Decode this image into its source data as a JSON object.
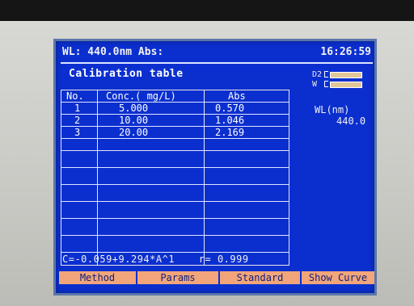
{
  "status_bar": {
    "wavelength_abs": "WL: 440.0nm Abs:",
    "time": "16:26:59"
  },
  "page": {
    "title": "Calibration table"
  },
  "lamps": [
    {
      "label": "D2"
    },
    {
      "label": "W"
    }
  ],
  "table": {
    "headers": [
      "No.",
      "Conc.( mg/L)",
      "Abs"
    ],
    "rows": [
      [
        "1",
        "5.000",
        "0.570"
      ],
      [
        "2",
        "10.00",
        "1.046"
      ],
      [
        "3",
        "20.00",
        "2.169"
      ],
      [
        "",
        "",
        ""
      ],
      [
        "",
        "",
        ""
      ],
      [
        "",
        "",
        ""
      ],
      [
        "",
        "",
        ""
      ],
      [
        "",
        "",
        ""
      ],
      [
        "",
        "",
        ""
      ],
      [
        "",
        "",
        ""
      ],
      [
        "",
        "",
        ""
      ],
      [
        "",
        "",
        ""
      ]
    ]
  },
  "side_panel": {
    "wl_label": "WL(nm)",
    "wl_value": "440.0"
  },
  "regression": {
    "equation": "C=-0.059+9.294*A^1",
    "r": "r= 0.999"
  },
  "softkeys": [
    "Method",
    "Params",
    "Standard",
    "Show Curve"
  ],
  "colors": {
    "screen_bg": "#0b2fcf",
    "softkey_bg": "#f2a57a",
    "text": "#ffffff"
  }
}
